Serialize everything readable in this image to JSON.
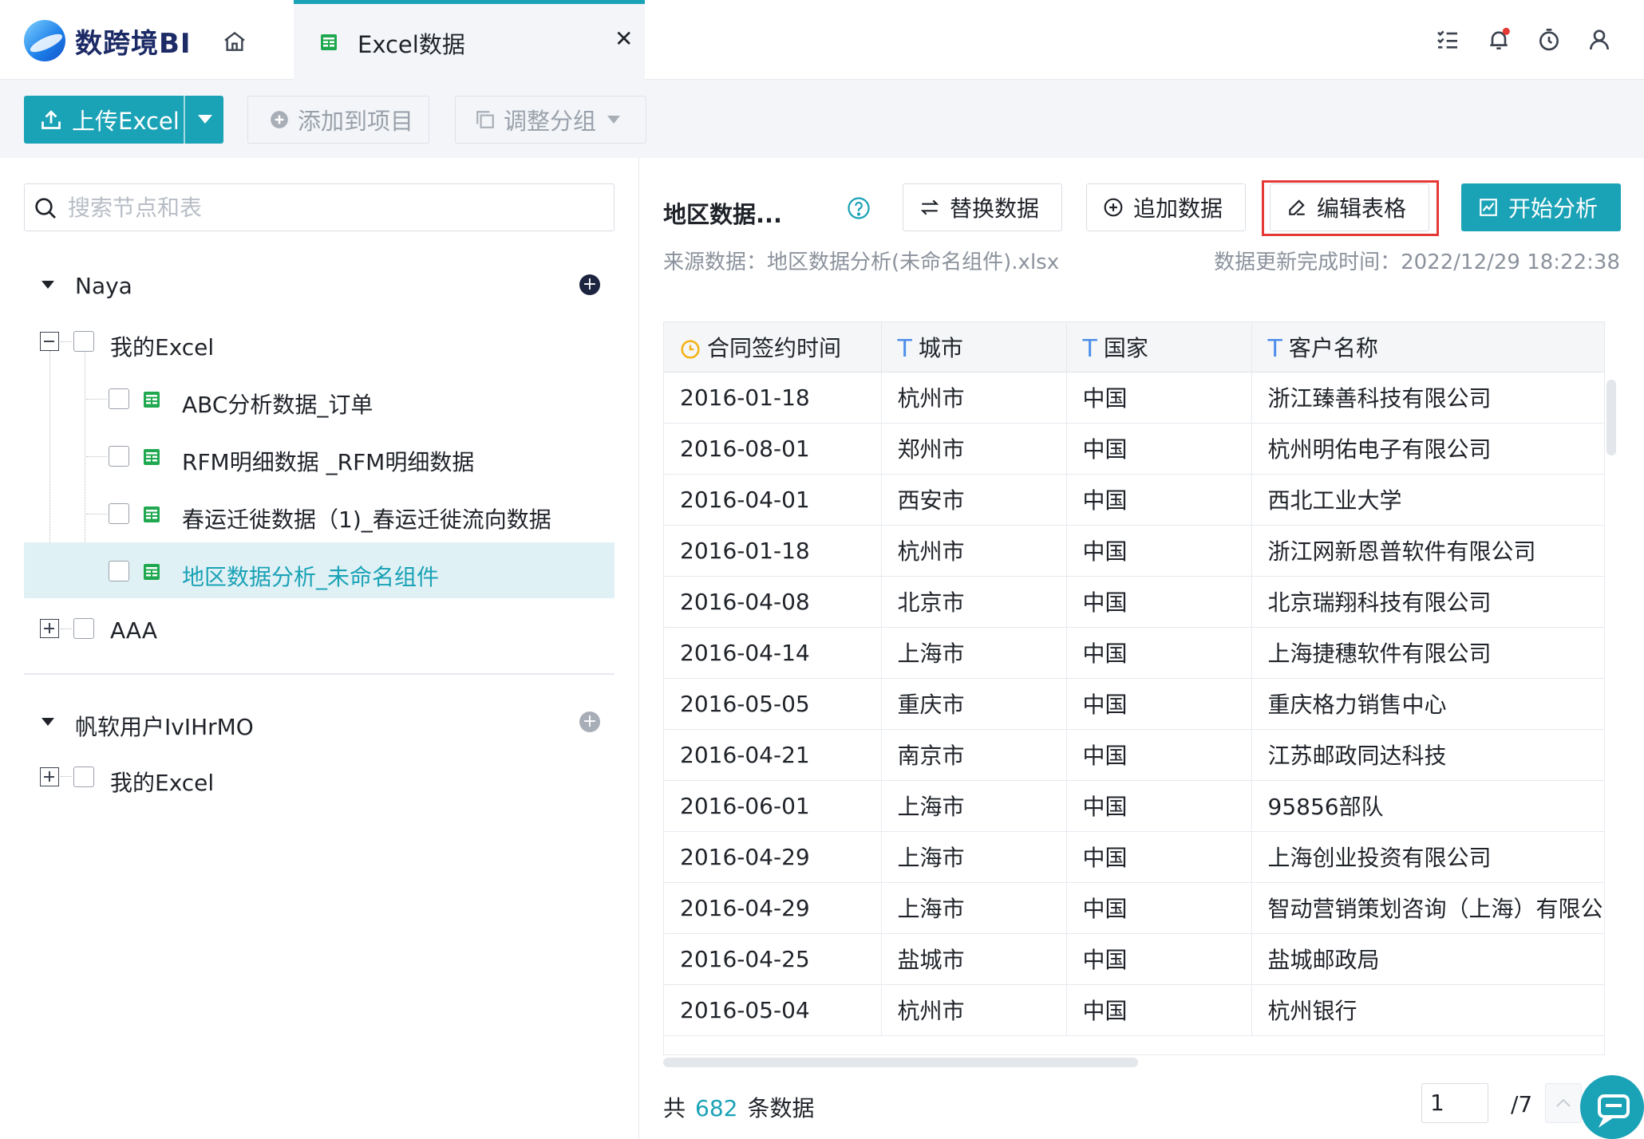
{
  "app": {
    "name": "数跨境BI"
  },
  "tab": {
    "label": "Excel数据"
  },
  "toolbar": {
    "upload": "上传Excel",
    "add_to_project": "添加到项目",
    "adjust_group": "调整分组"
  },
  "search": {
    "placeholder": "搜索节点和表"
  },
  "tree": {
    "group1": {
      "name": "Naya",
      "folder": "我的Excel",
      "items": [
        "ABC分析数据_订单",
        "RFM明细数据 _RFM明细数据",
        "春运迁徙数据（1)_春运迁徙流向数据",
        "地区数据分析_未命名组件"
      ],
      "folder2": "AAA"
    },
    "group2": {
      "name": "帆软用户IvIHrMO",
      "folder": "我的Excel"
    }
  },
  "dataset": {
    "title": "地区数据...",
    "actions": {
      "replace": "替换数据",
      "append": "追加数据",
      "edit": "编辑表格",
      "analyze": "开始分析"
    },
    "source": "来源数据：地区数据分析(未命名组件).xlsx",
    "updated": "数据更新完成时间：2022/12/29 18:22:38"
  },
  "table": {
    "columns": [
      {
        "label": "合同签约时间",
        "type": "date"
      },
      {
        "label": "城市",
        "type": "text"
      },
      {
        "label": "国家",
        "type": "text"
      },
      {
        "label": "客户名称",
        "type": "text"
      }
    ],
    "rows": [
      [
        "2016-01-18",
        "杭州市",
        "中国",
        "浙江臻善科技有限公司"
      ],
      [
        "2016-08-01",
        "郑州市",
        "中国",
        "杭州明佑电子有限公司"
      ],
      [
        "2016-04-01",
        "西安市",
        "中国",
        "西北工业大学"
      ],
      [
        "2016-01-18",
        "杭州市",
        "中国",
        "浙江网新恩普软件有限公司"
      ],
      [
        "2016-04-08",
        "北京市",
        "中国",
        "北京瑞翔科技有限公司"
      ],
      [
        "2016-04-14",
        "上海市",
        "中国",
        "上海捷穗软件有限公司"
      ],
      [
        "2016-05-05",
        "重庆市",
        "中国",
        "重庆格力销售中心"
      ],
      [
        "2016-04-21",
        "南京市",
        "中国",
        "江苏邮政同达科技"
      ],
      [
        "2016-06-01",
        "上海市",
        "中国",
        "95856部队"
      ],
      [
        "2016-04-29",
        "上海市",
        "中国",
        "上海创业投资有限公司"
      ],
      [
        "2016-04-29",
        "上海市",
        "中国",
        "智动营销策划咨询（上海）有限公司"
      ],
      [
        "2016-04-25",
        "盐城市",
        "中国",
        "盐城邮政局"
      ],
      [
        "2016-05-04",
        "杭州市",
        "中国",
        "杭州银行"
      ]
    ]
  },
  "footer": {
    "prefix": "共",
    "count": "682",
    "suffix": "条数据",
    "page": "1",
    "total": "/7"
  },
  "colors": {
    "accent": "#1aa2b6",
    "highlight": "#e53935"
  },
  "icons": {
    "home": "home-icon",
    "tasks": "task-list-icon",
    "bell": "bell-icon",
    "timer": "timer-icon",
    "user": "user-icon",
    "chat": "chat-icon"
  }
}
